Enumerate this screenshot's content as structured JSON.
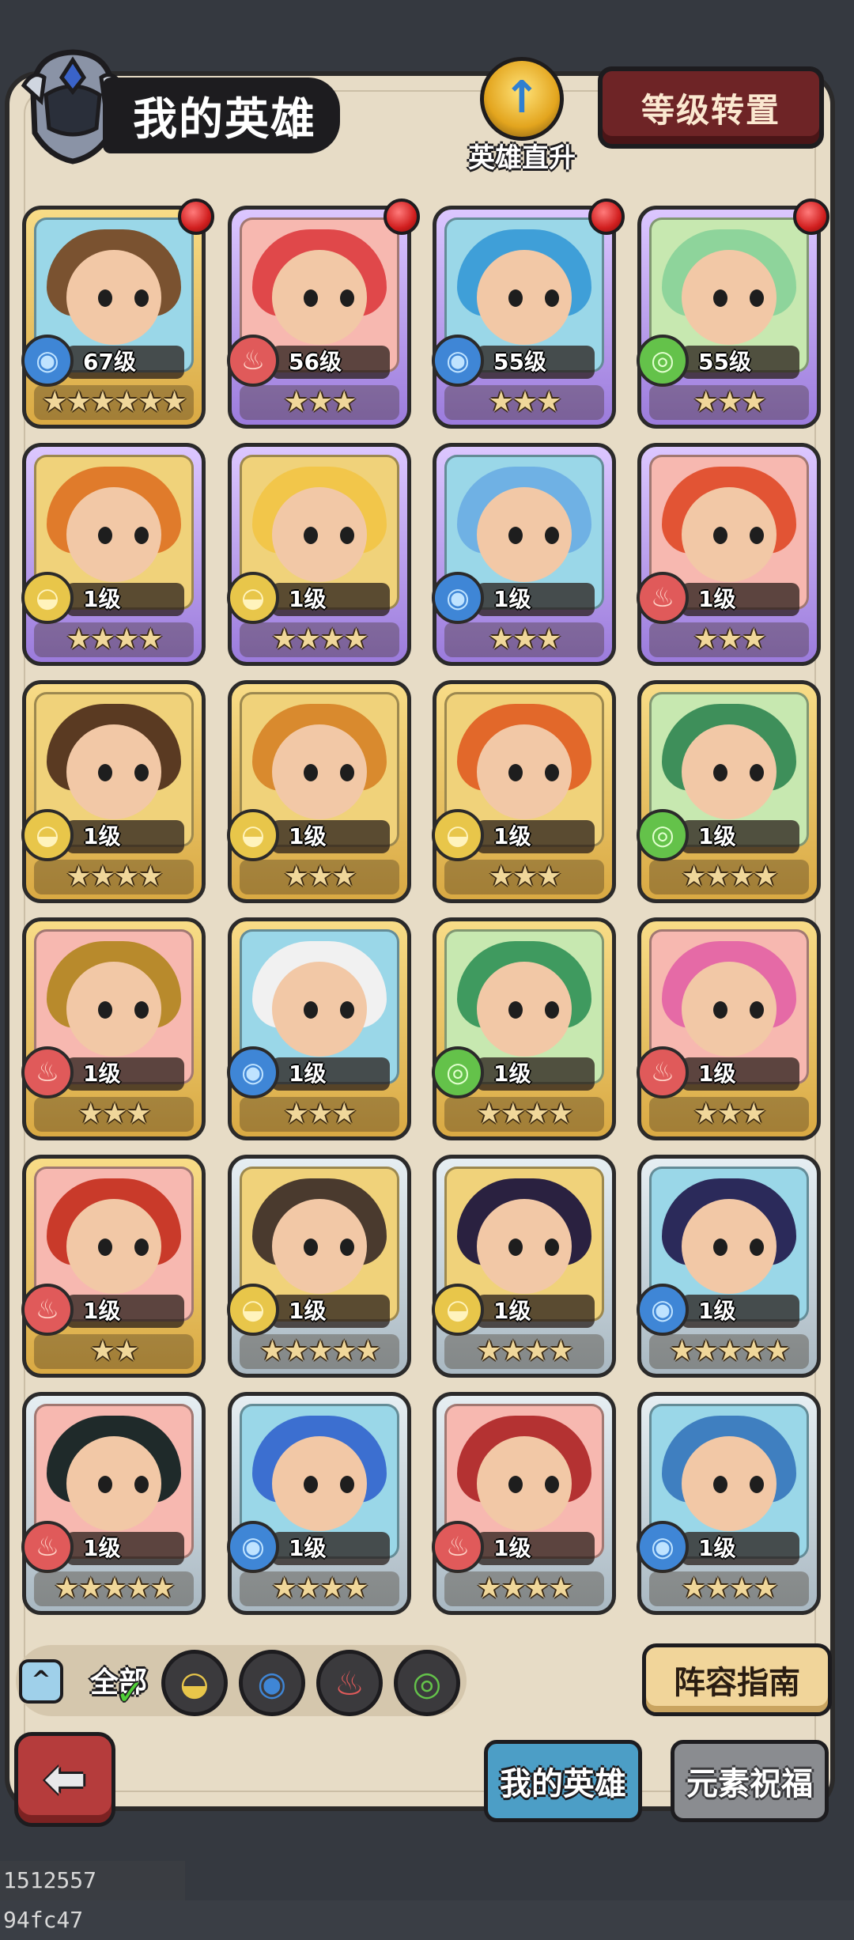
{
  "header": {
    "title": "我的英雄",
    "direct_upgrade_label": "英雄直升",
    "level_transfer_label": "等级转置"
  },
  "heroes": [
    {
      "level": "67级",
      "element": "water",
      "frame": "gold",
      "stars": "★★★★★★",
      "dot": true,
      "hair": "#7a5230",
      "bg": "#9ad7e8"
    },
    {
      "level": "56级",
      "element": "fire",
      "frame": "purple",
      "stars": "★★★",
      "dot": true,
      "hair": "#e0484a",
      "bg": "#f7b8b0"
    },
    {
      "level": "55级",
      "element": "water",
      "frame": "purple",
      "stars": "★★★",
      "dot": true,
      "hair": "#3f9fd8",
      "bg": "#9ad7e8"
    },
    {
      "level": "55级",
      "element": "wind",
      "frame": "purple",
      "stars": "★★★",
      "dot": true,
      "hair": "#8ed49b",
      "bg": "#c7e8b0"
    },
    {
      "level": "1级",
      "element": "earth",
      "frame": "purple",
      "stars": "★★★★",
      "dot": false,
      "hair": "#e07b2b",
      "bg": "#f0d27a"
    },
    {
      "level": "1级",
      "element": "earth",
      "frame": "purple",
      "stars": "★★★★",
      "dot": false,
      "hair": "#f2c64a",
      "bg": "#f0d27a"
    },
    {
      "level": "1级",
      "element": "water",
      "frame": "purple",
      "stars": "★★★",
      "dot": false,
      "hair": "#6fb1e4",
      "bg": "#9ad7e8"
    },
    {
      "level": "1级",
      "element": "fire",
      "frame": "purple",
      "stars": "★★★",
      "dot": false,
      "hair": "#e25434",
      "bg": "#f7b8b0"
    },
    {
      "level": "1级",
      "element": "earth",
      "frame": "gold",
      "stars": "★★★★",
      "dot": false,
      "hair": "#5a3a22",
      "bg": "#f0d27a"
    },
    {
      "level": "1级",
      "element": "earth",
      "frame": "gold",
      "stars": "★★★",
      "dot": false,
      "hair": "#d98a2e",
      "bg": "#f0d27a"
    },
    {
      "level": "1级",
      "element": "earth",
      "frame": "gold",
      "stars": "★★★",
      "dot": false,
      "hair": "#e2682a",
      "bg": "#f0d27a"
    },
    {
      "level": "1级",
      "element": "wind",
      "frame": "gold",
      "stars": "★★★★",
      "dot": false,
      "hair": "#3e8f5a",
      "bg": "#c7e8b0"
    },
    {
      "level": "1级",
      "element": "fire",
      "frame": "gold",
      "stars": "★★★",
      "dot": false,
      "hair": "#b88a2c",
      "bg": "#f7b8b0"
    },
    {
      "level": "1级",
      "element": "water",
      "frame": "gold",
      "stars": "★★★",
      "dot": false,
      "hair": "#f1f1f1",
      "bg": "#9ad7e8"
    },
    {
      "level": "1级",
      "element": "wind",
      "frame": "gold",
      "stars": "★★★★",
      "dot": false,
      "hair": "#3f9a5f",
      "bg": "#c7e8b0"
    },
    {
      "level": "1级",
      "element": "fire",
      "frame": "gold",
      "stars": "★★★",
      "dot": false,
      "hair": "#e56aa6",
      "bg": "#f7b8b0"
    },
    {
      "level": "1级",
      "element": "fire",
      "frame": "gold",
      "stars": "★★",
      "dot": false,
      "hair": "#c93a2a",
      "bg": "#f7b8b0"
    },
    {
      "level": "1级",
      "element": "earth",
      "frame": "silver",
      "stars": "★★★★★",
      "dot": false,
      "hair": "#4a3a2e",
      "bg": "#f0d27a"
    },
    {
      "level": "1级",
      "element": "earth",
      "frame": "silver",
      "stars": "★★★★",
      "dot": false,
      "hair": "#2a2140",
      "bg": "#f0d27a"
    },
    {
      "level": "1级",
      "element": "water",
      "frame": "silver",
      "stars": "★★★★★",
      "dot": false,
      "hair": "#2b2a5a",
      "bg": "#9ad7e8"
    },
    {
      "level": "1级",
      "element": "fire",
      "frame": "silver",
      "stars": "★★★★★",
      "dot": false,
      "hair": "#1f2a2a",
      "bg": "#f7b8b0"
    },
    {
      "level": "1级",
      "element": "water",
      "frame": "silver",
      "stars": "★★★★",
      "dot": false,
      "hair": "#3c6fd0",
      "bg": "#9ad7e8"
    },
    {
      "level": "1级",
      "element": "fire",
      "frame": "silver",
      "stars": "★★★★",
      "dot": false,
      "hair": "#b43232",
      "bg": "#f7b8b0"
    },
    {
      "level": "1级",
      "element": "water",
      "frame": "silver",
      "stars": "★★★★",
      "dot": false,
      "hair": "#3f7fc0",
      "bg": "#9ad7e8"
    }
  ],
  "filters": {
    "collapse_icon": "^",
    "all_label": "全部",
    "elements": [
      "earth",
      "water",
      "fire",
      "wind"
    ]
  },
  "guide_label": "阵容指南",
  "tabs": {
    "my_heroes": "我的英雄",
    "element_blessing": "元素祝福"
  },
  "back_icon": "arrow-left-icon",
  "footer_id": "1512557 94fc47",
  "element_glyphs": {
    "water": "◉",
    "fire": "♨",
    "wind": "◎",
    "earth": "◒"
  }
}
